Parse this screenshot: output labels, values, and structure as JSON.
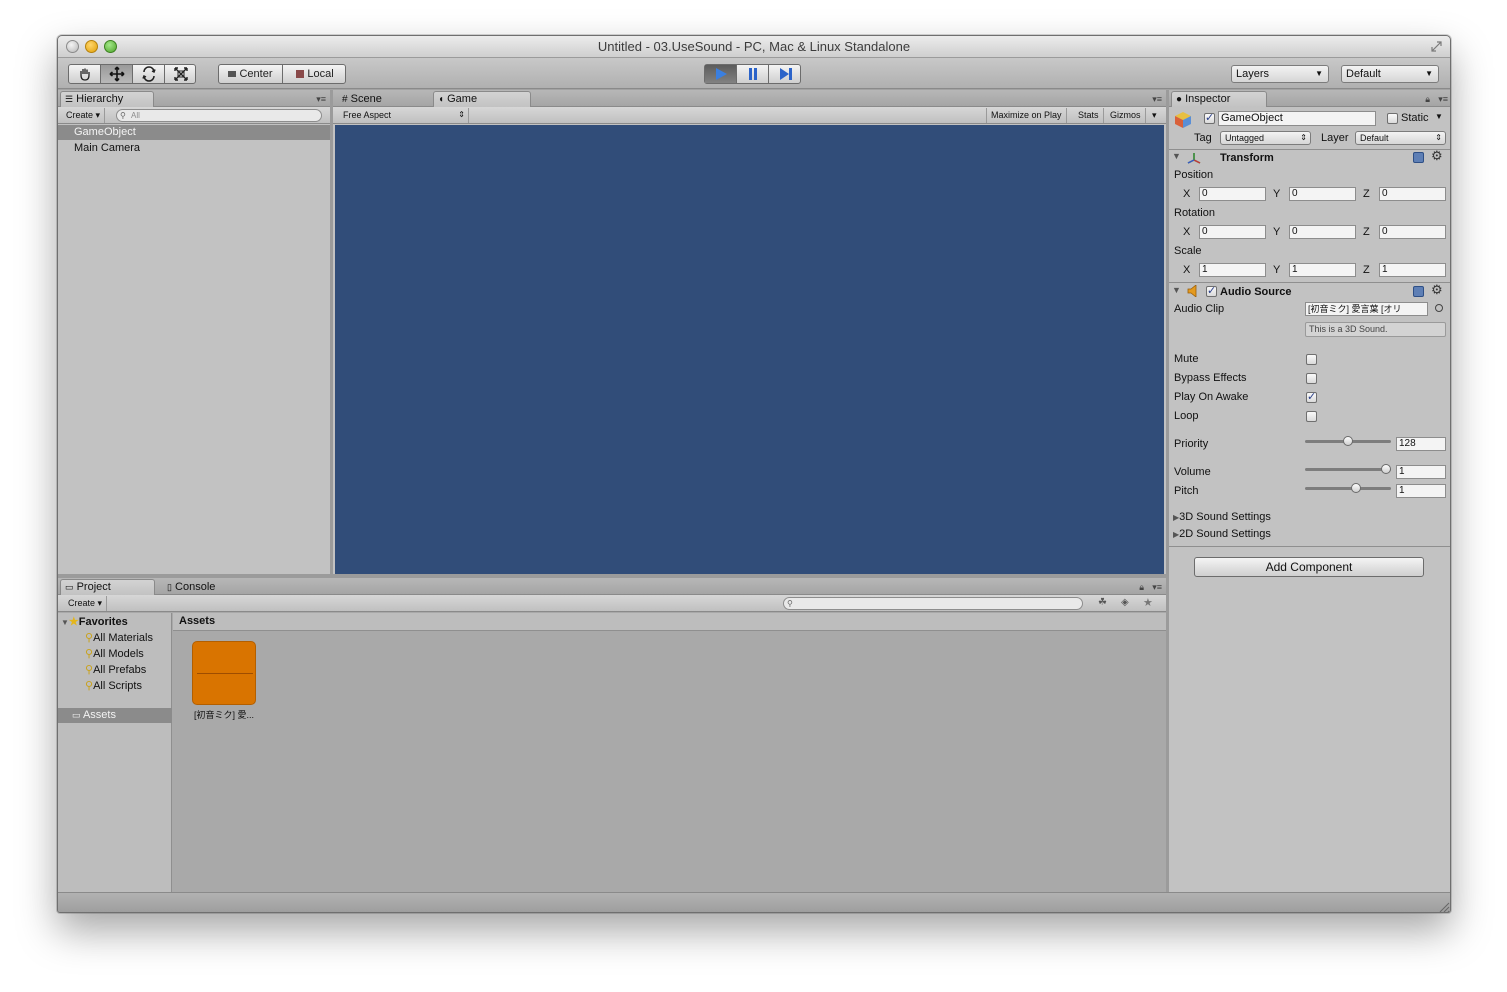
{
  "window": {
    "title": "Untitled - 03.UseSound - PC, Mac & Linux Standalone"
  },
  "toolbar": {
    "pivot_label": "Center",
    "space_label": "Local",
    "layers_label": "Layers",
    "layout_label": "Default",
    "play_color": "#3a7fe0"
  },
  "hierarchy": {
    "tab_label": "Hierarchy",
    "create_label": "Create",
    "search_placeholder": "All",
    "items": [
      {
        "label": "GameObject"
      },
      {
        "label": "Main Camera"
      }
    ]
  },
  "scene_tabs": {
    "scene_label": "Scene",
    "game_label": "Game",
    "aspect_label": "Free Aspect",
    "maximize_label": "Maximize on Play",
    "stats_label": "Stats",
    "gizmos_label": "Gizmos",
    "viewport_color": "#314d79"
  },
  "inspector": {
    "tab_label": "Inspector",
    "object_name": "GameObject",
    "static_label": "Static",
    "tag_label": "Tag",
    "tag_value": "Untagged",
    "layer_label": "Layer",
    "layer_value": "Default",
    "transform": {
      "title": "Transform",
      "position_label": "Position",
      "rotation_label": "Rotation",
      "scale_label": "Scale",
      "axis_x": "X",
      "axis_y": "Y",
      "axis_z": "Z",
      "position": [
        "0",
        "0",
        "0"
      ],
      "rotation": [
        "0",
        "0",
        "0"
      ],
      "scale": [
        "1",
        "1",
        "1"
      ]
    },
    "audio_source": {
      "title": "Audio Source",
      "clip_label": "Audio Clip",
      "clip_value": "[初音ミク] 愛言葉 [オリ",
      "note": "This is a 3D Sound.",
      "mute_label": "Mute",
      "bypass_label": "Bypass Effects",
      "play_on_awake_label": "Play On Awake",
      "loop_label": "Loop",
      "priority_label": "Priority",
      "priority_value": "128",
      "priority_fraction": 0.5,
      "volume_label": "Volume",
      "volume_value": "1",
      "volume_fraction": 1.0,
      "pitch_label": "Pitch",
      "pitch_value": "1",
      "pitch_fraction": 0.6,
      "settings_3d": "3D Sound Settings",
      "settings_2d": "2D Sound Settings",
      "play_on_awake_checked": true,
      "mute_checked": false,
      "bypass_checked": false,
      "loop_checked": false
    },
    "add_component_label": "Add Component"
  },
  "project": {
    "tab_label": "Project",
    "console_label": "Console",
    "create_label": "Create",
    "favorites_label": "Favorites",
    "favorites": [
      {
        "label": "All Materials"
      },
      {
        "label": "All Models"
      },
      {
        "label": "All Prefabs"
      },
      {
        "label": "All Scripts"
      }
    ],
    "assets_folder_label": "Assets",
    "assets_header": "Assets",
    "asset_items": [
      {
        "label": "[初音ミク] 愛..."
      }
    ],
    "asset_color": "#d97400"
  }
}
